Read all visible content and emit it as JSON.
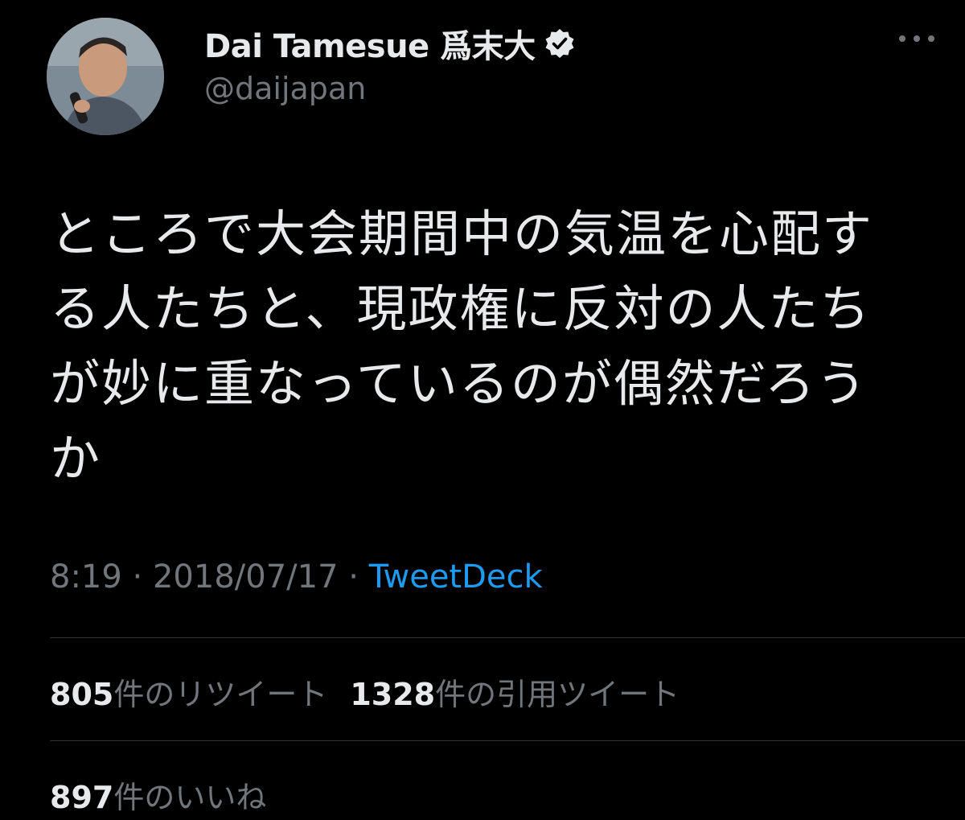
{
  "author": {
    "display_name": "Dai Tamesue 爲末大",
    "handle": "@daijapan",
    "verified_icon": "verified-badge-icon",
    "avatar_icon": "profile-photo"
  },
  "tweet": {
    "lines": [
      "ところで大会期間中の気温を心配す",
      "る人たちと、現政権に反対の人たち",
      "が妙に重なっているのが偶然だろう",
      "か"
    ]
  },
  "meta": {
    "time": "8:19",
    "separator": " · ",
    "date": "2018/07/17",
    "source": "TweetDeck"
  },
  "stats": {
    "retweets_count": "805",
    "retweets_label": "件のリツイート",
    "quotes_count": "1328",
    "quotes_label": "件の引用ツイート",
    "likes_count": "897",
    "likes_label": "件のいいね"
  },
  "colors": {
    "background": "#000000",
    "text": "#e7e9ea",
    "secondary": "#71767b",
    "link": "#1d9bf0",
    "divider": "#2f3336"
  }
}
